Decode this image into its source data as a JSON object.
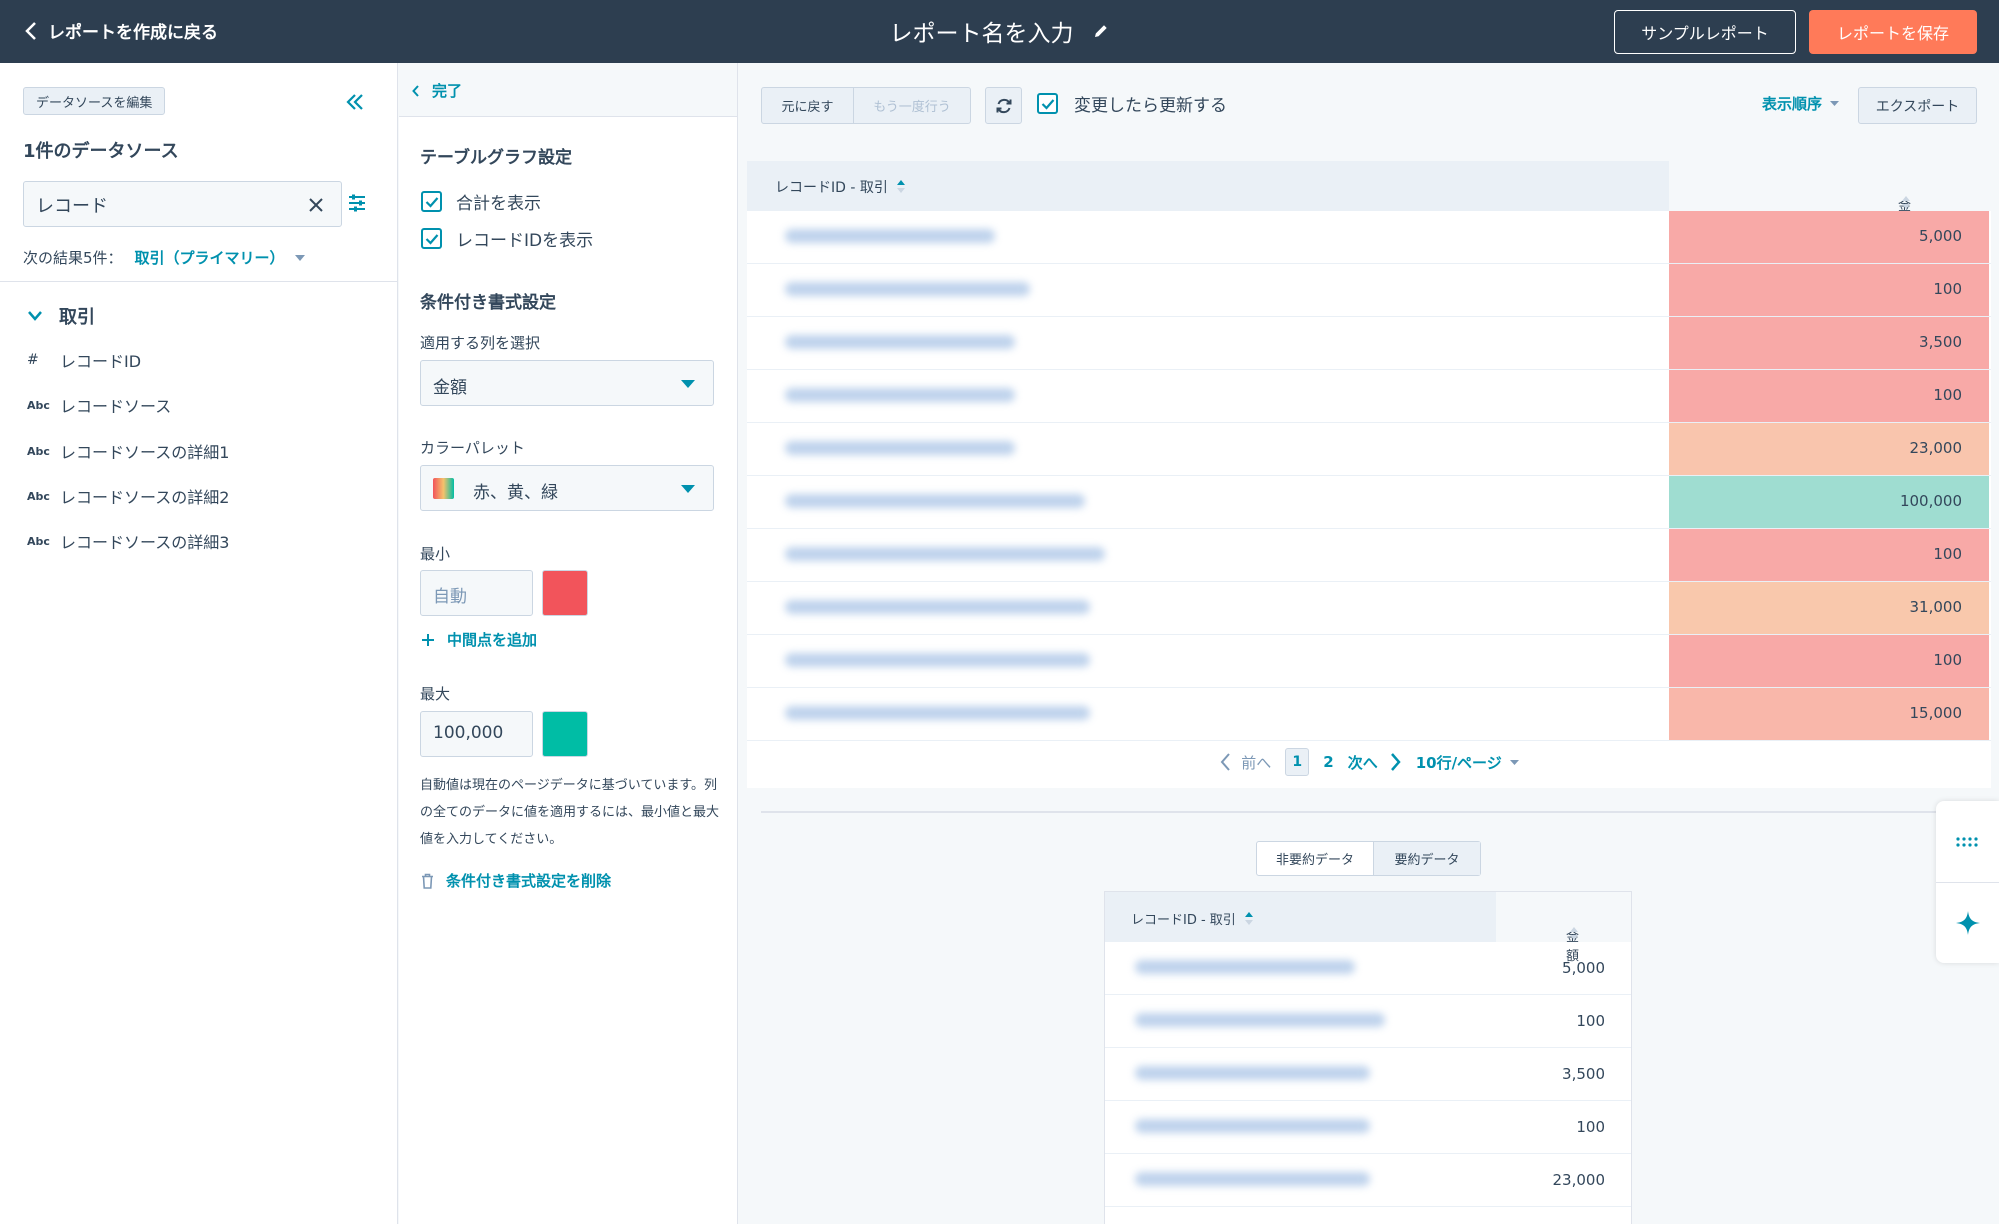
{
  "topbar": {
    "back_label": "レポートを作成に戻る",
    "report_title": "レポート名を入力",
    "sample_report_label": "サンプルレポート",
    "save_label": "レポートを保存"
  },
  "datasource_panel": {
    "edit_button": "データソースを編集",
    "count_title": "1件のデータソース",
    "search_value": "レコード",
    "results_prefix": "次の結果5件：",
    "results_object": "取引（プライマリー）",
    "group_label": "取引",
    "properties": [
      {
        "type": "#",
        "label": "レコードID"
      },
      {
        "type": "Abc",
        "label": "レコードソース"
      },
      {
        "type": "Abc",
        "label": "レコードソースの詳細1"
      },
      {
        "type": "Abc",
        "label": "レコードソースの詳細2"
      },
      {
        "type": "Abc",
        "label": "レコードソースの詳細3"
      }
    ]
  },
  "settings_panel": {
    "done_label": "完了",
    "table_settings_title": "テーブルグラフ設定",
    "show_total_label": "合計を表示",
    "show_record_id_label": "レコードIDを表示",
    "conditional_title": "条件付き書式設定",
    "apply_column_label": "適用する列を選択",
    "apply_column_value": "金額",
    "palette_label": "カラーパレット",
    "palette_value": "赤、黄、緑",
    "min_label": "最小",
    "min_placeholder": "自動",
    "min_color": "#f2545b",
    "add_midpoint_label": "中間点を追加",
    "max_label": "最大",
    "max_value": "100,000",
    "max_color": "#00bda5",
    "help_text": "自動値は現在のページデータに基づいています。列の全てのデータに値を適用するには、最小値と最大値を入力してください。",
    "delete_label": "条件付き書式設定を削除"
  },
  "toolbar": {
    "undo_label": "元に戻す",
    "redo_label": "もう一度行う",
    "auto_update_label": "変更したら更新する",
    "sort_label": "表示順序",
    "export_label": "エクスポート"
  },
  "main_table": {
    "col_record": "レコードID - 取引",
    "col_amount": "金額",
    "rows": [
      {
        "amount": "5,000",
        "color": "#f8a9a7"
      },
      {
        "amount": "100",
        "color": "#f8a9a7"
      },
      {
        "amount": "3,500",
        "color": "#f8a9a7"
      },
      {
        "amount": "100",
        "color": "#f8a9a7"
      },
      {
        "amount": "23,000",
        "color": "#f9c5ad"
      },
      {
        "amount": "100,000",
        "color": "#9fddd1"
      },
      {
        "amount": "100",
        "color": "#f8a9a7"
      },
      {
        "amount": "31,000",
        "color": "#f9c8ac"
      },
      {
        "amount": "100",
        "color": "#f8a9a7"
      },
      {
        "amount": "15,000",
        "color": "#f9b7aa"
      }
    ],
    "pager": {
      "prev_label": "前へ",
      "current_page": "1",
      "next_page": "2",
      "next_label": "次へ",
      "rows_per_page": "10行/ページ"
    }
  },
  "summary": {
    "tab_raw": "非要約データ",
    "tab_summary": "要約データ",
    "col_record": "レコードID - 取引",
    "col_amount": "金額",
    "rows": [
      {
        "amount": "5,000"
      },
      {
        "amount": "100"
      },
      {
        "amount": "3,500"
      },
      {
        "amount": "100"
      },
      {
        "amount": "23,000"
      }
    ]
  },
  "colors": {
    "accent": "#0091ae",
    "save_button": "#ff7a59",
    "topbar": "#2d3e50"
  }
}
